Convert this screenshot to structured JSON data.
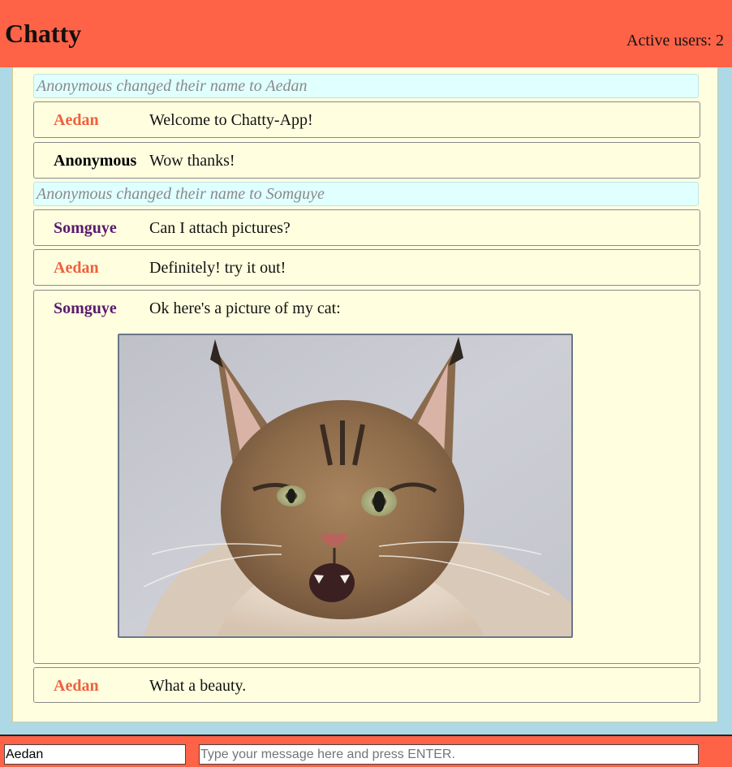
{
  "app": {
    "title": "Chatty",
    "active_users_label": "Active users: 2"
  },
  "colors": {
    "header_bg": "#ff6347",
    "page_bg": "#add8e6",
    "messages_bg": "#ffffe0",
    "system_bg": "#e0ffff",
    "aedan": "#f0603e",
    "anonymous": "#000000",
    "somguye": "#5a1a6e"
  },
  "messages": [
    {
      "type": "system",
      "text": "Anonymous changed their name to Aedan"
    },
    {
      "type": "chat",
      "user": "Aedan",
      "content": "Welcome to Chatty-App!"
    },
    {
      "type": "chat",
      "user": "Anonymous",
      "content": "Wow thanks!"
    },
    {
      "type": "system",
      "text": "Anonymous changed their name to Somguye"
    },
    {
      "type": "chat",
      "user": "Somguye",
      "content": "Can I attach pictures?"
    },
    {
      "type": "chat",
      "user": "Aedan",
      "content": "Definitely! try it out!"
    },
    {
      "type": "chat",
      "user": "Somguye",
      "content": "Ok here's a picture of my cat:",
      "image": "cat-photo"
    },
    {
      "type": "chat",
      "user": "Aedan",
      "content": "What a beauty."
    }
  ],
  "chatbar": {
    "username_value": "Aedan",
    "message_placeholder": "Type your message here and press ENTER."
  }
}
